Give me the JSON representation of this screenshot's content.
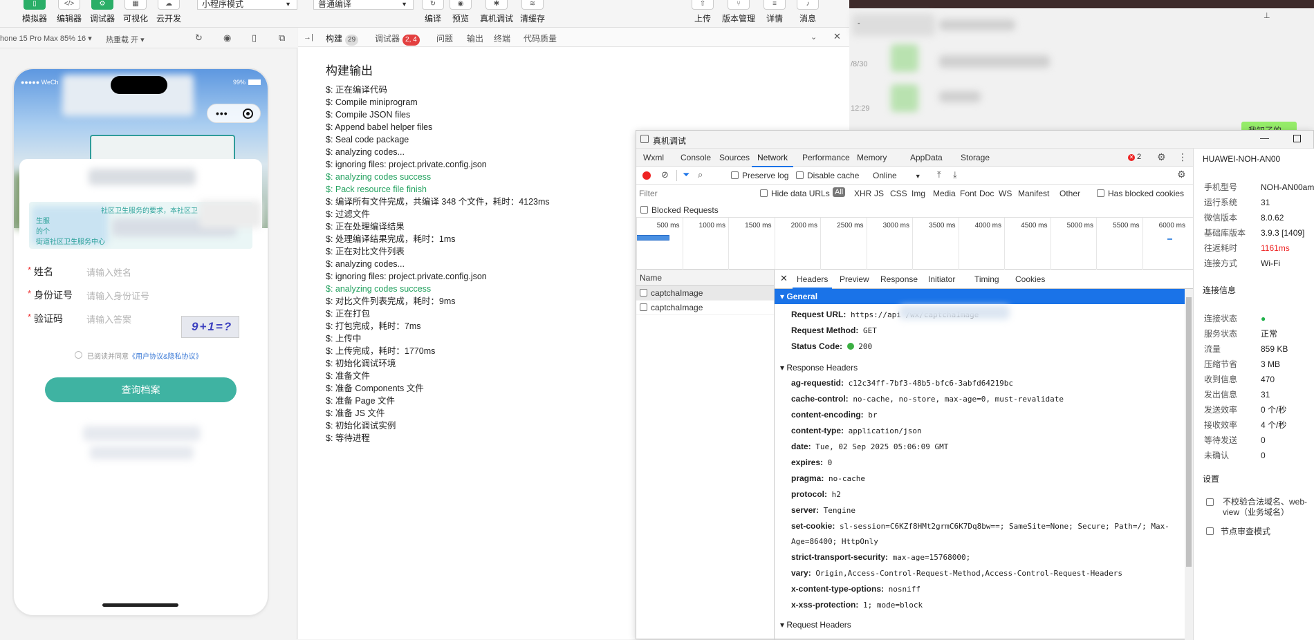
{
  "toolbar": {
    "buttons": [
      {
        "label": "模拟器"
      },
      {
        "label": "编辑器"
      },
      {
        "label": "调试器"
      },
      {
        "label": "可视化"
      },
      {
        "label": "云开发"
      }
    ],
    "mode_select": "小程序模式",
    "compile_select": "普通编译",
    "actions": [
      {
        "label": "编译"
      },
      {
        "label": "预览"
      },
      {
        "label": "真机调试"
      },
      {
        "label": "清缓存"
      }
    ],
    "right_actions": [
      {
        "label": "上传"
      },
      {
        "label": "版本管理"
      },
      {
        "label": "详情"
      },
      {
        "label": "消息"
      }
    ]
  },
  "simbar": {
    "device": "hone 15 Pro Max 85% 16 ▾",
    "hotreload": "热重载 开 ▾"
  },
  "phone": {
    "status_left": "●●●●● WeCh",
    "status_right": "99%",
    "notice_text": "社区卫生服务的要求，本社区卫",
    "notice_text2": "生服",
    "notice_text3": "的个",
    "notice_text4": "街道社区卫生服务中心",
    "fields": [
      {
        "label": "姓名",
        "placeholder": "请输入姓名"
      },
      {
        "label": "身份证号",
        "placeholder": "请输入身份证号"
      },
      {
        "label": "验证码",
        "placeholder": "请输入答案"
      }
    ],
    "captcha_text": "9+1=?",
    "agree_prefix": "已阅读并同意",
    "agree_link": "《用户协议&隐私协议》",
    "query_button": "查询档案"
  },
  "editor": {
    "tabs": [
      {
        "label": "构建",
        "badge": "29"
      },
      {
        "label": "调试器",
        "badge": "2, 4"
      },
      {
        "label": "问题"
      },
      {
        "label": "输出"
      },
      {
        "label": "终端"
      },
      {
        "label": "代码质量"
      }
    ],
    "title": "构建输出",
    "lines": [
      {
        "text": "$: 正在编译代码",
        "ok": false
      },
      {
        "text": "$: Compile miniprogram",
        "ok": false
      },
      {
        "text": "$: Compile JSON files",
        "ok": false
      },
      {
        "text": "$: Append babel helper files",
        "ok": false
      },
      {
        "text": "$: Seal code package",
        "ok": false
      },
      {
        "text": "$: analyzing codes...",
        "ok": false
      },
      {
        "text": "$: ignoring files: project.private.config.json",
        "ok": false
      },
      {
        "text": "$: analyzing codes success",
        "ok": true
      },
      {
        "text": "$: Pack resource file finish",
        "ok": true
      },
      {
        "text": "$: 编译所有文件完成，共编译 348 个文件，耗时：4123ms",
        "ok": false
      },
      {
        "text": "$: 过滤文件",
        "ok": false
      },
      {
        "text": "$: 正在处理编译结果",
        "ok": false
      },
      {
        "text": "$: 处理编译结果完成，耗时：1ms",
        "ok": false
      },
      {
        "text": "$: 正在对比文件列表",
        "ok": false
      },
      {
        "text": "$: analyzing codes...",
        "ok": false
      },
      {
        "text": "$: ignoring files: project.private.config.json",
        "ok": false
      },
      {
        "text": "$: analyzing codes success",
        "ok": true
      },
      {
        "text": "$: 对比文件列表完成，耗时：9ms",
        "ok": false
      },
      {
        "text": "$: 正在打包",
        "ok": false
      },
      {
        "text": "$: 打包完成，耗时：7ms",
        "ok": false
      },
      {
        "text": "$: 上传中",
        "ok": false
      },
      {
        "text": "$: 上传完成，耗时：1770ms",
        "ok": false
      },
      {
        "text": "$: 初始化调试环境",
        "ok": false
      },
      {
        "text": "$: 准备文件",
        "ok": false
      },
      {
        "text": "$: 准备 Components 文件",
        "ok": false
      },
      {
        "text": "$: 准备 Page 文件",
        "ok": false
      },
      {
        "text": "$: 准备 JS 文件",
        "ok": false
      },
      {
        "text": "$: 初始化调试实例",
        "ok": false
      },
      {
        "text": "$: 等待进程",
        "ok": false
      }
    ]
  },
  "chat": {
    "dates": [
      "/8/30",
      "12:29"
    ],
    "bubble": "我知了的"
  },
  "devtools": {
    "window_title": "真机调试",
    "tabs": [
      "Wxml",
      "Console",
      "Sources",
      "Network",
      "Performance",
      "Memory",
      "AppData",
      "Storage"
    ],
    "active_tab": "Network",
    "error_count": "2",
    "preserve_log": "Preserve log",
    "disable_cache": "Disable cache",
    "throttle": "Online",
    "filter_placeholder": "Filter",
    "hide_data_urls": "Hide data URLs",
    "type_filters": [
      "All",
      "XHR",
      "JS",
      "CSS",
      "Img",
      "Media",
      "Font",
      "Doc",
      "WS",
      "Manifest",
      "Other"
    ],
    "has_blocked_cookies": "Has blocked cookies",
    "blocked_requests": "Blocked Requests",
    "timeline_ticks": [
      "500 ms",
      "1000 ms",
      "1500 ms",
      "2000 ms",
      "2500 ms",
      "3000 ms",
      "3500 ms",
      "4000 ms",
      "4500 ms",
      "5000 ms",
      "5500 ms",
      "6000 ms"
    ],
    "list_header": "Name",
    "requests": [
      "captchaImage",
      "captchaImage"
    ],
    "detail_tabs": [
      "Headers",
      "Preview",
      "Response",
      "Initiator",
      "Timing",
      "Cookies"
    ],
    "general_title": "General",
    "general": [
      {
        "k": "Request URL:",
        "v": "https://api                                /wx/captchaImage"
      },
      {
        "k": "Request Method:",
        "v": "GET"
      },
      {
        "k": "Status Code:",
        "v": "200"
      }
    ],
    "response_title": "Response Headers",
    "response_headers": [
      {
        "k": "ag-requestid:",
        "v": "c12c34ff-7bf3-48b5-bfc6-3abfd64219bc"
      },
      {
        "k": "cache-control:",
        "v": "no-cache, no-store, max-age=0, must-revalidate"
      },
      {
        "k": "content-encoding:",
        "v": "br"
      },
      {
        "k": "content-type:",
        "v": "application/json"
      },
      {
        "k": "date:",
        "v": "Tue, 02 Sep 2025 05:06:09 GMT"
      },
      {
        "k": "expires:",
        "v": "0"
      },
      {
        "k": "pragma:",
        "v": "no-cache"
      },
      {
        "k": "protocol:",
        "v": "h2"
      },
      {
        "k": "server:",
        "v": "Tengine"
      },
      {
        "k": "set-cookie:",
        "v": "sl-session=C6KZf8HMt2grmC6K7Dq8bw==; SameSite=None; Secure; Path=/; Max-Age=86400; HttpOnly"
      },
      {
        "k": "strict-transport-security:",
        "v": "max-age=15768000;"
      },
      {
        "k": "vary:",
        "v": "Origin,Access-Control-Request-Method,Access-Control-Request-Headers"
      },
      {
        "k": "x-content-type-options:",
        "v": "nosniff"
      },
      {
        "k": "x-xss-protection:",
        "v": "1; mode=block"
      }
    ],
    "request_title": "Request Headers"
  },
  "deviceinfo": {
    "device_name": "HUAWEI-NOH-AN00",
    "rows": [
      {
        "k": "手机型号",
        "v": "NOH-AN00am"
      },
      {
        "k": "运行系统",
        "v": "31"
      },
      {
        "k": "微信版本",
        "v": "8.0.62"
      },
      {
        "k": "基础库版本",
        "v": "3.9.3 [1409]"
      },
      {
        "k": "往返耗时",
        "v": "1161ms",
        "red": true
      },
      {
        "k": "连接方式",
        "v": "Wi-Fi"
      }
    ],
    "conn_title": "连接信息",
    "conn_rows": [
      {
        "k": "连接状态",
        "v": "●"
      },
      {
        "k": "服务状态",
        "v": "正常"
      },
      {
        "k": "流量",
        "v": "859 KB"
      },
      {
        "k": "压缩节省",
        "v": "3 MB"
      },
      {
        "k": "收到信息",
        "v": "470"
      },
      {
        "k": "发出信息",
        "v": "31"
      },
      {
        "k": "发送效率",
        "v": "0 个/秒"
      },
      {
        "k": "接收效率",
        "v": "4 个/秒"
      },
      {
        "k": "等待发送",
        "v": "0"
      },
      {
        "k": "未确认",
        "v": "0"
      }
    ],
    "settings_title": "设置",
    "settings": [
      "不校验合法域名、web-view（业务域名）",
      "节点审查模式"
    ]
  }
}
